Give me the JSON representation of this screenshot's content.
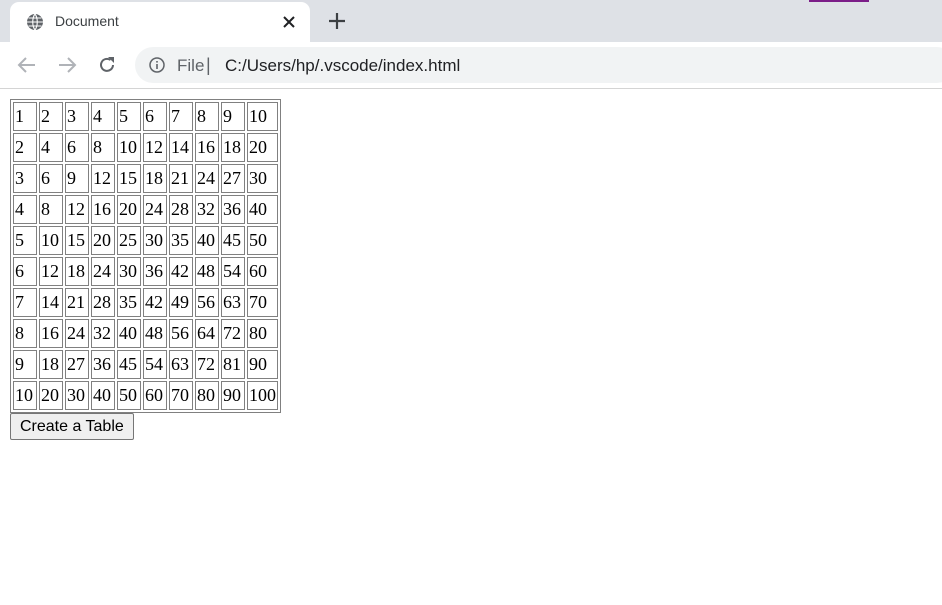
{
  "browser": {
    "tab_title": "Document",
    "address": {
      "scheme_label": "File",
      "separator": "|",
      "url": "C:/Users/hp/.vscode/index.html"
    },
    "icons": {
      "favicon": "globe-icon",
      "close": "close-icon",
      "new_tab": "plus-icon",
      "back": "arrow-left-icon",
      "forward": "arrow-right-icon",
      "reload": "reload-icon",
      "info": "info-icon"
    }
  },
  "page": {
    "table_rows": [
      [
        "1",
        "2",
        "3",
        "4",
        "5",
        "6",
        "7",
        "8",
        "9",
        "10"
      ],
      [
        "2",
        "4",
        "6",
        "8",
        "10",
        "12",
        "14",
        "16",
        "18",
        "20"
      ],
      [
        "3",
        "6",
        "9",
        "12",
        "15",
        "18",
        "21",
        "24",
        "27",
        "30"
      ],
      [
        "4",
        "8",
        "12",
        "16",
        "20",
        "24",
        "28",
        "32",
        "36",
        "40"
      ],
      [
        "5",
        "10",
        "15",
        "20",
        "25",
        "30",
        "35",
        "40",
        "45",
        "50"
      ],
      [
        "6",
        "12",
        "18",
        "24",
        "30",
        "36",
        "42",
        "48",
        "54",
        "60"
      ],
      [
        "7",
        "14",
        "21",
        "28",
        "35",
        "42",
        "49",
        "56",
        "63",
        "70"
      ],
      [
        "8",
        "16",
        "24",
        "32",
        "40",
        "48",
        "56",
        "64",
        "72",
        "80"
      ],
      [
        "9",
        "18",
        "27",
        "36",
        "45",
        "54",
        "63",
        "72",
        "81",
        "90"
      ],
      [
        "10",
        "20",
        "30",
        "40",
        "50",
        "60",
        "70",
        "80",
        "90",
        "100"
      ]
    ],
    "button_label": "Create a Table"
  },
  "colors": {
    "tabstrip_bg": "#dee1e6",
    "omnibox_bg": "#f1f3f4",
    "profile_accent": "#7b1d88"
  }
}
